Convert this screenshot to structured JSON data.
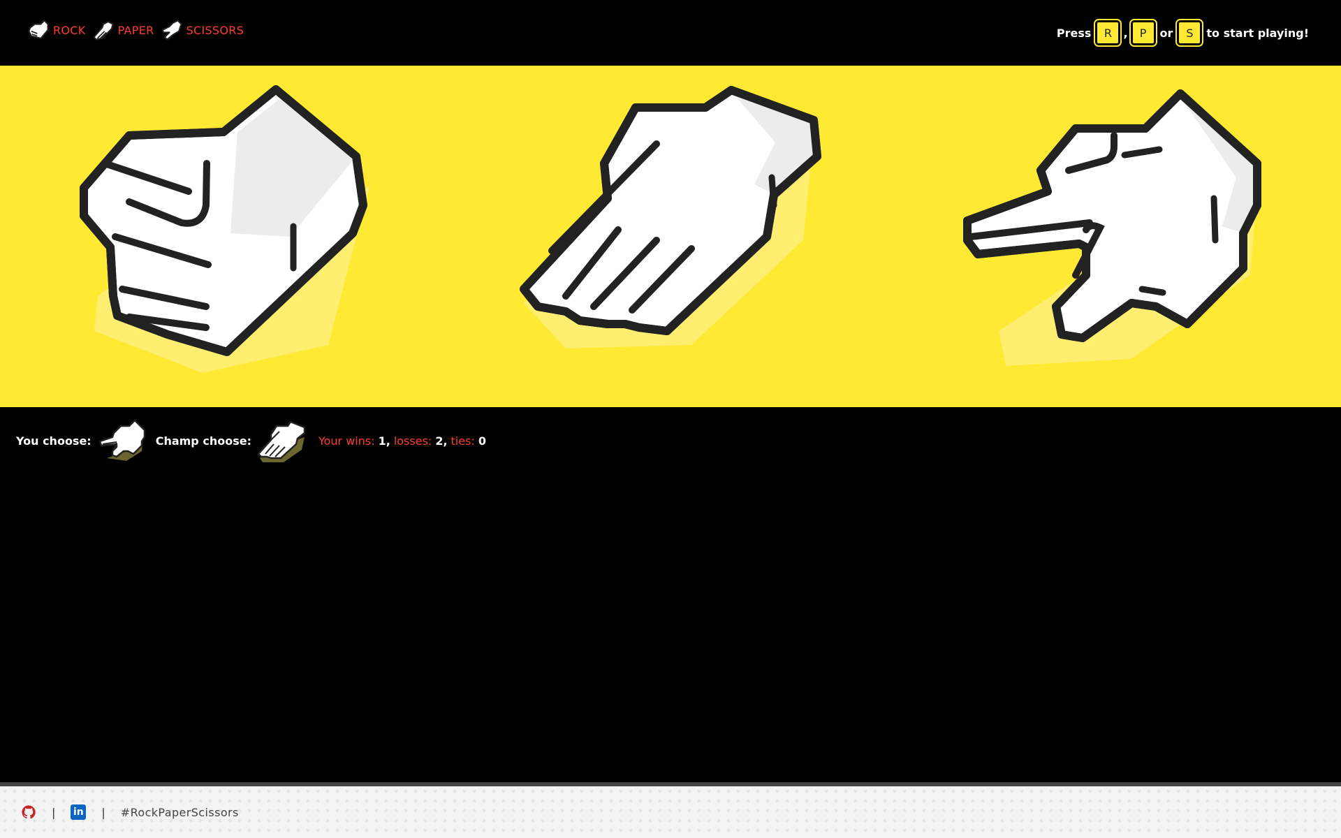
{
  "nav": {
    "items": [
      {
        "label": "ROCK",
        "icon": "rock-hand-icon"
      },
      {
        "label": "PAPER",
        "icon": "paper-hand-icon"
      },
      {
        "label": "SCISSORS",
        "icon": "scissors-hand-icon"
      }
    ]
  },
  "instructions": {
    "press": "Press",
    "keys": [
      "R",
      "P",
      "S"
    ],
    "comma": ",",
    "or": "or",
    "suffix": "to start playing!"
  },
  "board": {
    "choices": [
      "rock",
      "paper",
      "scissors"
    ],
    "background": "#ffe933"
  },
  "status": {
    "you_label": "You choose:",
    "you_choice": "scissors",
    "champ_label": "Champ choose:",
    "champ_choice": "paper",
    "wins_label": "Your wins:",
    "wins": "1,",
    "losses_label": "losses:",
    "losses": "2,",
    "ties_label": "ties:",
    "ties": "0"
  },
  "footer": {
    "github_icon": "github-icon",
    "linkedin_icon": "linkedin-icon",
    "linkedin_text": "in",
    "separator": "|",
    "hashtag": "#RockPaperScissors"
  },
  "colors": {
    "accent_red": "#ff3b2f",
    "yellow": "#ffe933",
    "black": "#000000"
  }
}
